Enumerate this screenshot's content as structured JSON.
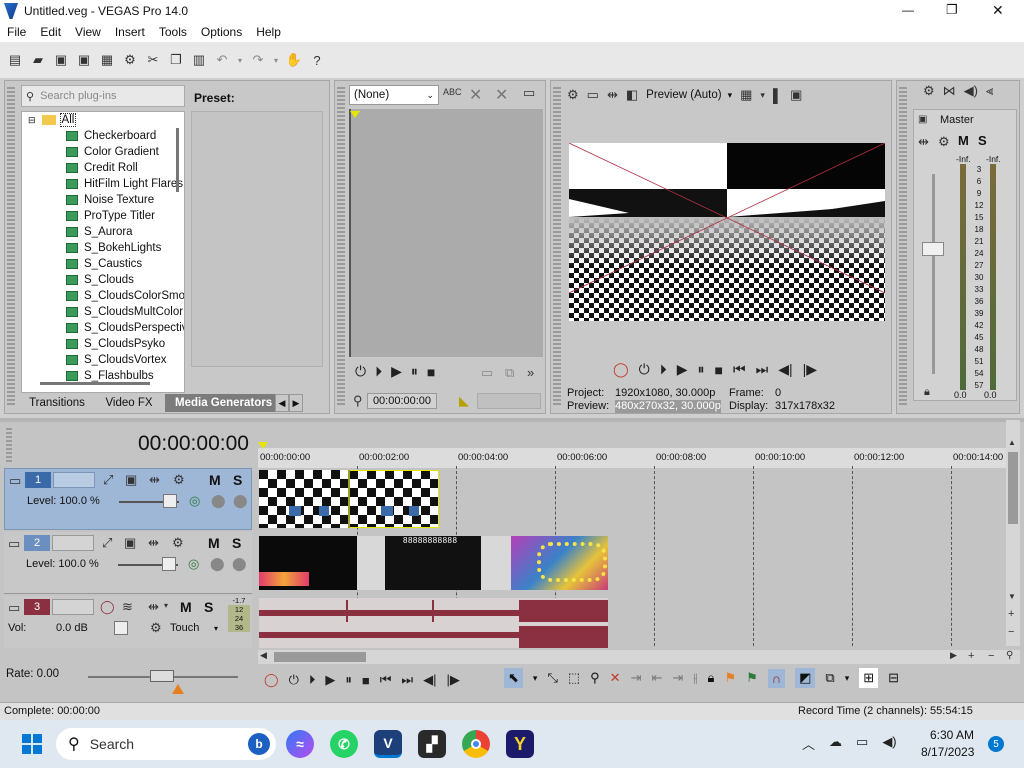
{
  "window": {
    "title": "Untitled.veg - VEGAS Pro 14.0",
    "minimize": "—",
    "maximize": "❐",
    "close": "✕"
  },
  "menu": [
    "File",
    "Edit",
    "View",
    "Insert",
    "Tools",
    "Options",
    "Help"
  ],
  "plugins": {
    "search_placeholder": "Search plug-ins",
    "preset_label": "Preset:",
    "root": "All",
    "items": [
      "Checkerboard",
      "Color Gradient",
      "Credit Roll",
      "HitFilm Light Flares",
      "Noise Texture",
      "ProType Titler",
      "S_Aurora",
      "S_BokehLights",
      "S_Caustics",
      "S_Clouds",
      "S_CloudsColorSmooth",
      "S_CloudsMultColor",
      "S_CloudsPerspective",
      "S_CloudsPsyko",
      "S_CloudsVortex",
      "S_Flashbulbs"
    ],
    "tabs": [
      "Transitions",
      "Video FX",
      "Media Generators"
    ]
  },
  "trimmer": {
    "dropdown": "(None)",
    "timecode": "00:00:00:00"
  },
  "preview": {
    "mode": "Preview (Auto)",
    "project_label": "Project:",
    "project_value": "1920x1080, 30.000p",
    "preview_label": "Preview:",
    "preview_value": "480x270x32, 30.000p",
    "frame_label": "Frame:",
    "frame_value": "0",
    "display_label": "Display:",
    "display_value": "317x178x32"
  },
  "master": {
    "label": "Master",
    "m": "M",
    "s": "S",
    "peak_left": "-Inf.",
    "peak_right": "-Inf.",
    "scale": [
      "3",
      "6",
      "9",
      "12",
      "15",
      "18",
      "21",
      "24",
      "27",
      "30",
      "33",
      "36",
      "39",
      "42",
      "45",
      "48",
      "51",
      "54",
      "57"
    ],
    "value_left": "0.0",
    "value_right": "0.0"
  },
  "timeline": {
    "timecode": "00:00:00:00",
    "ruler": [
      "00:00:00:00",
      "00:00:02:00",
      "00:00:04:00",
      "00:00:06:00",
      "00:00:08:00",
      "00:00:10:00",
      "00:00:12:00",
      "00:00:14:00"
    ],
    "tracks": [
      {
        "num": "1",
        "level": "Level: 100.0 %",
        "m": "M",
        "s": "S"
      },
      {
        "num": "2",
        "level": "Level: 100.0 %",
        "m": "M",
        "s": "S"
      },
      {
        "num": "3",
        "vol_label": "Vol:",
        "vol_value": "0.0 dB",
        "touch": "Touch",
        "m": "M",
        "s": "S",
        "meter": [
          "-1.7",
          "12",
          "24",
          "36"
        ]
      }
    ],
    "rate": "Rate: 0.00"
  },
  "clip": {
    "banner": "88888888888"
  },
  "status": {
    "left": "Complete: 00:00:00",
    "right": "Record Time (2 channels): 55:54:15"
  },
  "taskbar": {
    "search": "Search",
    "time": "6:30 AM",
    "date": "8/17/2023",
    "notif": "5"
  },
  "colors": {
    "track_selected": "#9fb7d6",
    "audio_wave": "#8b3040",
    "accent": "#0078d4"
  }
}
